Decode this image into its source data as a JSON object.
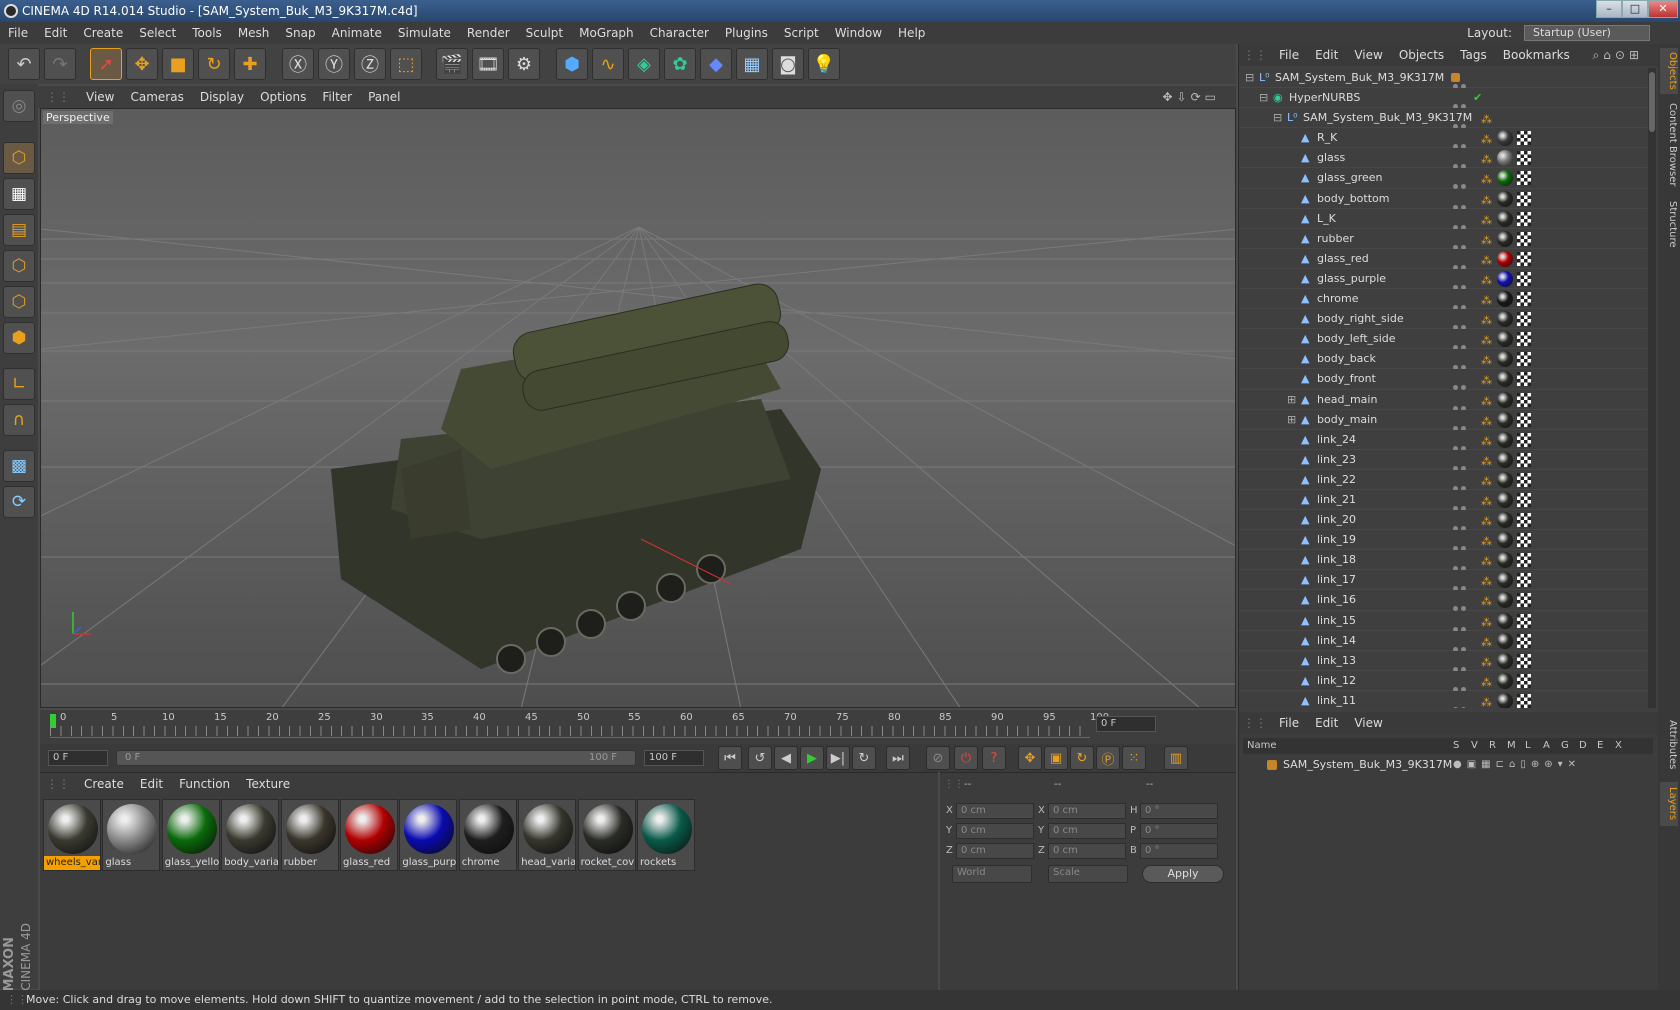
{
  "title_bar": {
    "title": "CINEMA 4D R14.014 Studio - [SAM_System_Buk_M3_9K317M.c4d]",
    "minimize_icon": "minimize-icon",
    "maximize_icon": "maximize-icon",
    "close_icon": "close-icon"
  },
  "menu": [
    "File",
    "Edit",
    "Create",
    "Select",
    "Tools",
    "Mesh",
    "Snap",
    "Animate",
    "Simulate",
    "Render",
    "Sculpt",
    "MoGraph",
    "Character",
    "Plugins",
    "Script",
    "Window",
    "Help"
  ],
  "layout": {
    "label": "Layout:",
    "value": "Startup (User)"
  },
  "viewport": {
    "menu": [
      "View",
      "Cameras",
      "Display",
      "Options",
      "Filter",
      "Panel"
    ],
    "label": "Perspective"
  },
  "timeline": {
    "ticks": [
      "0",
      "5",
      "10",
      "15",
      "20",
      "25",
      "30",
      "35",
      "40",
      "45",
      "50",
      "55",
      "60",
      "65",
      "70",
      "75",
      "80",
      "85",
      "90",
      "95",
      "100"
    ],
    "current_frame": "0 F",
    "start_field": "0 F",
    "range_start": "0 F",
    "range_end": "100 F",
    "end_field": "100 F"
  },
  "material_manager": {
    "menu": [
      "Create",
      "Edit",
      "Function",
      "Texture"
    ],
    "materials": [
      {
        "label": "wheels_var",
        "color": "#3a3a32"
      },
      {
        "label": "glass",
        "color": "#8a8a8a"
      },
      {
        "label": "glass_yello",
        "color": "#0a6a0a"
      },
      {
        "label": "body_varia",
        "color": "#3a3a30"
      },
      {
        "label": "rubber",
        "color": "#3a362c"
      },
      {
        "label": "glass_red",
        "color": "#b00000"
      },
      {
        "label": "glass_purp",
        "color": "#0a0ab0"
      },
      {
        "label": "chrome",
        "color": "#1e1e1e"
      },
      {
        "label": "head_varia",
        "color": "#36362e"
      },
      {
        "label": "rocket_cov",
        "color": "#2a2c26"
      },
      {
        "label": "rockets",
        "color": "#0a5a4a"
      }
    ]
  },
  "coordinates": {
    "header": [
      "--",
      "--",
      "--"
    ],
    "rows": [
      {
        "a": "X",
        "av": "0 cm",
        "b": "X",
        "bv": "0 cm",
        "c": "H",
        "cv": "0 °"
      },
      {
        "a": "Y",
        "av": "0 cm",
        "b": "Y",
        "bv": "0 cm",
        "c": "P",
        "cv": "0 °"
      },
      {
        "a": "Z",
        "av": "0 cm",
        "b": "Z",
        "bv": "0 cm",
        "c": "B",
        "cv": "0 °"
      }
    ],
    "mode_world": "World",
    "mode_scale": "Scale",
    "apply": "Apply"
  },
  "object_manager": {
    "menu": [
      "File",
      "Edit",
      "View",
      "Objects",
      "Tags",
      "Bookmarks"
    ],
    "objects": [
      {
        "name": "SAM_System_Buk_M3_9K317M",
        "level": 0,
        "expand": "−",
        "icon": "null"
      },
      {
        "name": "HyperNURBS",
        "level": 1,
        "expand": "−",
        "icon": "nurbs"
      },
      {
        "name": "SAM_System_Buk_M3_9K317M",
        "level": 2,
        "expand": "−",
        "icon": "null"
      },
      {
        "name": "R_K",
        "level": 3,
        "tag": "#3a3a3a"
      },
      {
        "name": "glass",
        "level": 3,
        "tag": "#7a7a7a"
      },
      {
        "name": "glass_green",
        "level": 3,
        "tag": "#0a6a0a"
      },
      {
        "name": "body_bottom",
        "level": 3,
        "tag": "#2a2a26"
      },
      {
        "name": "L_K",
        "level": 3,
        "tag": "#2a2a26"
      },
      {
        "name": "rubber",
        "level": 3,
        "tag": "#2a2824"
      },
      {
        "name": "glass_red",
        "level": 3,
        "tag": "#b00000"
      },
      {
        "name": "glass_purple",
        "level": 3,
        "tag": "#1010b0"
      },
      {
        "name": "chrome",
        "level": 3,
        "tag": "#181818"
      },
      {
        "name": "body_right_side",
        "level": 3,
        "tag": "#2a2a26"
      },
      {
        "name": "body_left_side",
        "level": 3,
        "tag": "#2a2a26"
      },
      {
        "name": "body_back",
        "level": 3,
        "tag": "#2a2a26"
      },
      {
        "name": "body_front",
        "level": 3,
        "tag": "#2a2a26"
      },
      {
        "name": "head_main",
        "level": 3,
        "expand": "+",
        "tag": "#2a2a26"
      },
      {
        "name": "body_main",
        "level": 3,
        "expand": "+",
        "tag": "#2a2a26"
      },
      {
        "name": "link_24",
        "level": 3,
        "tag": "#2a2a26"
      },
      {
        "name": "link_23",
        "level": 3,
        "tag": "#2a2a26"
      },
      {
        "name": "link_22",
        "level": 3,
        "tag": "#2a2a26"
      },
      {
        "name": "link_21",
        "level": 3,
        "tag": "#2a2a26"
      },
      {
        "name": "link_20",
        "level": 3,
        "tag": "#2a2a26"
      },
      {
        "name": "link_19",
        "level": 3,
        "tag": "#2a2a26"
      },
      {
        "name": "link_18",
        "level": 3,
        "tag": "#2a2a26"
      },
      {
        "name": "link_17",
        "level": 3,
        "tag": "#2a2a26"
      },
      {
        "name": "link_16",
        "level": 3,
        "tag": "#2a2a26"
      },
      {
        "name": "link_15",
        "level": 3,
        "tag": "#2a2a26"
      },
      {
        "name": "link_14",
        "level": 3,
        "tag": "#2a2a26"
      },
      {
        "name": "link_13",
        "level": 3,
        "tag": "#2a2a26"
      },
      {
        "name": "link_12",
        "level": 3,
        "tag": "#2a2a26"
      },
      {
        "name": "link_11",
        "level": 3,
        "tag": "#2a2a26"
      }
    ]
  },
  "layer_manager": {
    "menu": [
      "File",
      "Edit",
      "View"
    ],
    "columns": [
      "Name",
      "S",
      "V",
      "R",
      "M",
      "L",
      "A",
      "G",
      "D",
      "E",
      "X"
    ],
    "layer_name": "SAM_System_Buk_M3_9K317M"
  },
  "side_tabs": [
    "Objects",
    "Content Browser",
    "Structure",
    "Attributes",
    "Layers"
  ],
  "brand": {
    "maxon": "MAXON",
    "cinema": "CINEMA 4D"
  },
  "status": "Move: Click and drag to move elements. Hold down SHIFT to quantize movement / add to the selection in point mode, CTRL to remove.",
  "colors": {
    "accent": "#e9a01f",
    "highlight": "#f5a000"
  }
}
